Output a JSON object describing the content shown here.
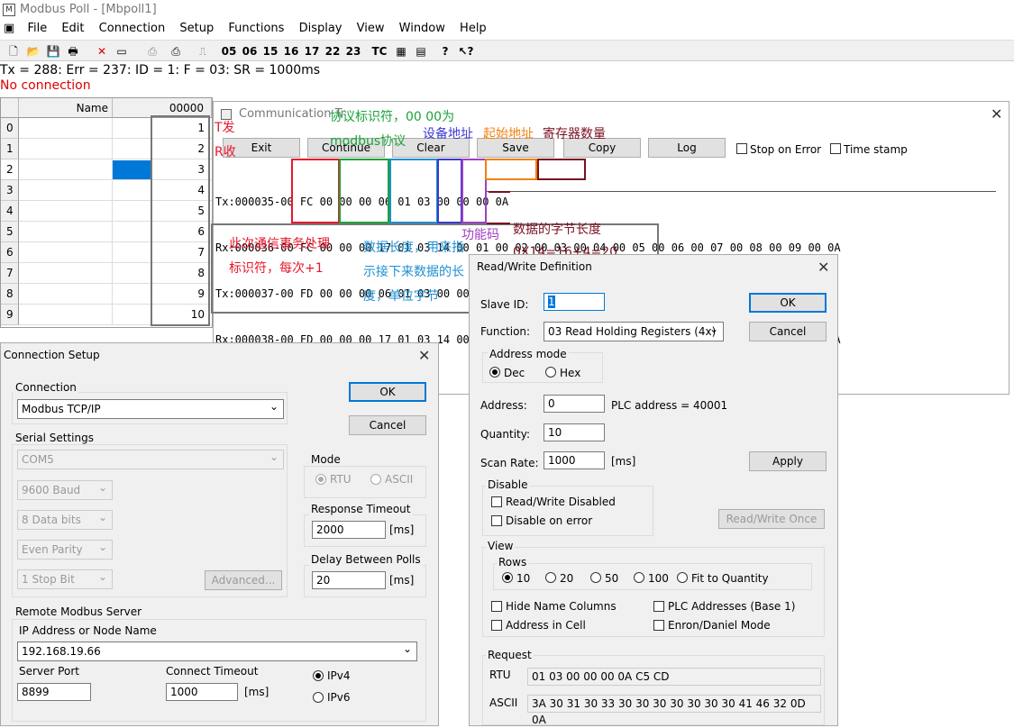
{
  "app": {
    "title": "Modbus Poll - [Mbpoll1]",
    "icon": "modbus-app-icon"
  },
  "menu": [
    "File",
    "Edit",
    "Connection",
    "Setup",
    "Functions",
    "Display",
    "View",
    "Window",
    "Help"
  ],
  "toolbar": {
    "fc_buttons": [
      "05",
      "06",
      "15",
      "16",
      "17",
      "22",
      "23"
    ],
    "tc_label": "TC"
  },
  "status": {
    "line1": "Tx = 288: Err = 237: ID = 1: F = 03: SR = 1000ms",
    "line2": "No connection"
  },
  "grid": {
    "col_name": "Name",
    "col_value": "00000",
    "rows": [
      {
        "n": "0",
        "v": "1"
      },
      {
        "n": "1",
        "v": "2"
      },
      {
        "n": "2",
        "v": "3"
      },
      {
        "n": "3",
        "v": "4"
      },
      {
        "n": "4",
        "v": "5"
      },
      {
        "n": "5",
        "v": "6"
      },
      {
        "n": "6",
        "v": "7"
      },
      {
        "n": "7",
        "v": "8"
      },
      {
        "n": "8",
        "v": "9"
      },
      {
        "n": "9",
        "v": "10"
      }
    ]
  },
  "comm": {
    "title": "Communication Tr",
    "buttons": [
      "Exit",
      "Continue",
      "Clear",
      "Save",
      "Copy",
      "Log"
    ],
    "stop_on_error": "Stop on Error",
    "time_stamp": "Time stamp",
    "lines": [
      {
        "pre": "Tx:000035-",
        "body": "00 FC 00 00 00 06 01 03 00 00 00 0A"
      },
      {
        "pre": "Rx:000036-",
        "body": "00 FC 00 00 00 17 01 03 14 00 01 00 02 00 03 00 04 00 05 00 06 00 07 00 08 00 09 00 0A"
      },
      {
        "pre": "Tx:000037-",
        "body": "00 FD 00 00 00 06 01 03 00 00 00 0A"
      },
      {
        "pre": "Rx:000038-",
        "body": "00 FD 00 00 00 17 01 03 14 00 01 00 02 00 03 00 04 00 05 00 06 00 07 00 08 00 09 00 0A"
      }
    ]
  },
  "annotations": {
    "t_send": "T发",
    "r_recv": "R收",
    "protocol": "协议标识符，00 00为",
    "protocol2": "modbus协议",
    "device": "设备地址",
    "start": "起始地址",
    "reg_count": "寄存器数量",
    "txn1": "此次通信事务处理",
    "txn2": "标识符，每次+1",
    "len1": "数据长度，用来指",
    "len2": "示接下来数据的长",
    "len3": "度，单位字节",
    "func": "功能码",
    "bytelen": "数据的字节长度",
    "calc": "0X14=16+4=20"
  },
  "colors": {
    "red": "#e8172c",
    "green": "#1aa33a",
    "blue": "#1e8fd0",
    "navy": "#3b3bd0",
    "purple": "#a040c0",
    "orange": "#f08010",
    "maroon": "#7a1020",
    "select": "#0078d7"
  },
  "rw": {
    "title": "Read/Write Definition",
    "slave_label": "Slave ID:",
    "slave_value": "1",
    "ok": "OK",
    "cancel": "Cancel",
    "function_label": "Function:",
    "function_value": "03 Read Holding Registers (4x)",
    "address_mode": "Address mode",
    "dec": "Dec",
    "hex": "Hex",
    "address_label": "Address:",
    "address_value": "0",
    "plc_address": "PLC address = 40001",
    "quantity_label": "Quantity:",
    "quantity_value": "10",
    "scan_label": "Scan Rate:",
    "scan_value": "1000",
    "scan_unit": "[ms]",
    "apply": "Apply",
    "disable": "Disable",
    "rw_disabled": "Read/Write Disabled",
    "disable_on_error": "Disable on error",
    "rw_once": "Read/Write Once",
    "view": "View",
    "rows": "Rows",
    "r10": "10",
    "r20": "20",
    "r50": "50",
    "r100": "100",
    "fit": "Fit to Quantity",
    "hide_names": "Hide Name Columns",
    "plc_addresses": "PLC Addresses (Base 1)",
    "address_in_cell": "Address in Cell",
    "enron": "Enron/Daniel Mode",
    "request": "Request",
    "rtu_label": "RTU",
    "rtu_value": "01 03 00 00 00 0A C5 CD",
    "ascii_label": "ASCII",
    "ascii_value": "3A 30 31 30 33 30 30 30 30 30 30 30 41 46 32 0D 0A"
  },
  "conn": {
    "title": "Connection Setup",
    "connection": "Connection",
    "connection_value": "Modbus TCP/IP",
    "ok": "OK",
    "cancel": "Cancel",
    "serial": "Serial Settings",
    "port": "COM5",
    "baud": "9600 Baud",
    "data_bits": "8 Data bits",
    "parity": "Even Parity",
    "stop_bit": "1 Stop Bit",
    "advanced": "Advanced...",
    "mode": "Mode",
    "rtu": "RTU",
    "ascii": "ASCII",
    "resp_timeout": "Response Timeout",
    "resp_value": "2000",
    "ms": "[ms]",
    "delay": "Delay Between Polls",
    "delay_value": "20",
    "remote": "Remote Modbus Server",
    "ip_label": "IP Address or Node Name",
    "ip_value": "192.168.19.66",
    "server_port": "Server Port",
    "port_value": "8899",
    "connect_timeout": "Connect Timeout",
    "timeout_value": "1000",
    "ipv4": "IPv4",
    "ipv6": "IPv6"
  }
}
